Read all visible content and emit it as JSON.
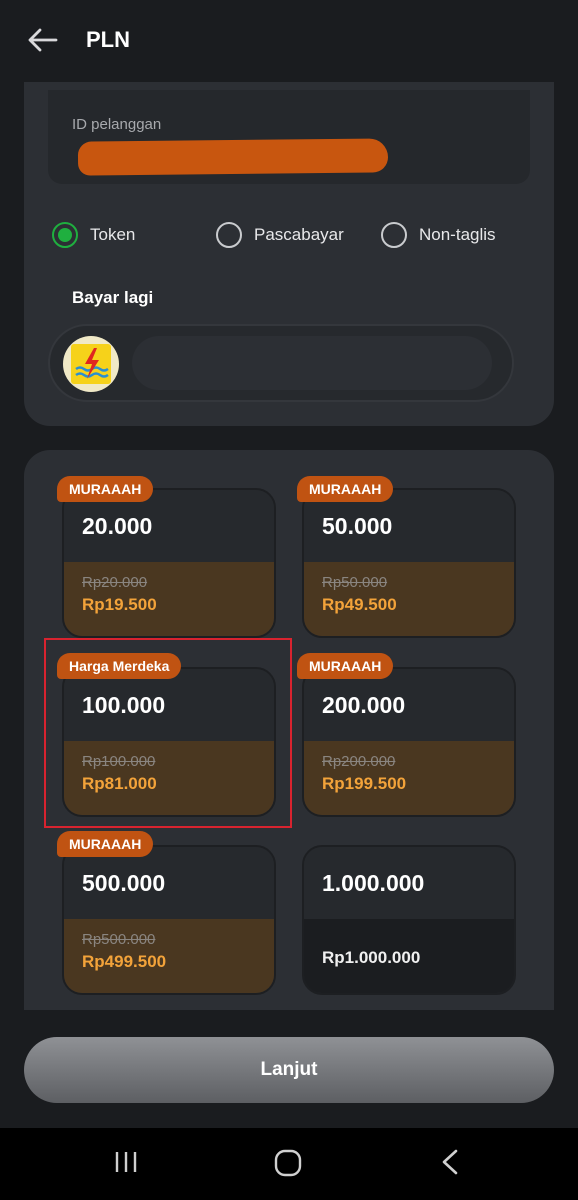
{
  "header": {
    "title": "PLN"
  },
  "customer": {
    "id_label": "ID pelanggan",
    "id_value": ""
  },
  "payment_types": [
    {
      "label": "Token",
      "selected": true
    },
    {
      "label": "Pascabayar",
      "selected": false
    },
    {
      "label": "Non-taglis",
      "selected": false
    }
  ],
  "pay_again": {
    "title": "Bayar lagi"
  },
  "products": [
    {
      "badge": "MURAAAH",
      "denomination": "20.000",
      "original_price": "Rp20.000",
      "price": "Rp19.500"
    },
    {
      "badge": "MURAAAH",
      "denomination": "50.000",
      "original_price": "Rp50.000",
      "price": "Rp49.500"
    },
    {
      "badge": "Harga Merdeka",
      "denomination": "100.000",
      "original_price": "Rp100.000",
      "price": "Rp81.000"
    },
    {
      "badge": "MURAAAH",
      "denomination": "200.000",
      "original_price": "Rp200.000",
      "price": "Rp199.500"
    },
    {
      "badge": "MURAAAH",
      "denomination": "500.000",
      "original_price": "Rp500.000",
      "price": "Rp499.500"
    },
    {
      "badge": "",
      "denomination": "1.000.000",
      "original_price": "",
      "price": "Rp1.000.000"
    }
  ],
  "actions": {
    "continue_label": "Lanjut"
  },
  "colors": {
    "accent_orange": "#f3a33a",
    "badge": "#c05312",
    "selected_green": "#1faf3f",
    "highlight_red": "#d8232f"
  },
  "icons": {
    "back": "arrow-left-icon",
    "logo": "pln-logo-icon",
    "nav_recent": "recent-apps-icon",
    "nav_home": "home-icon",
    "nav_back": "back-icon"
  }
}
